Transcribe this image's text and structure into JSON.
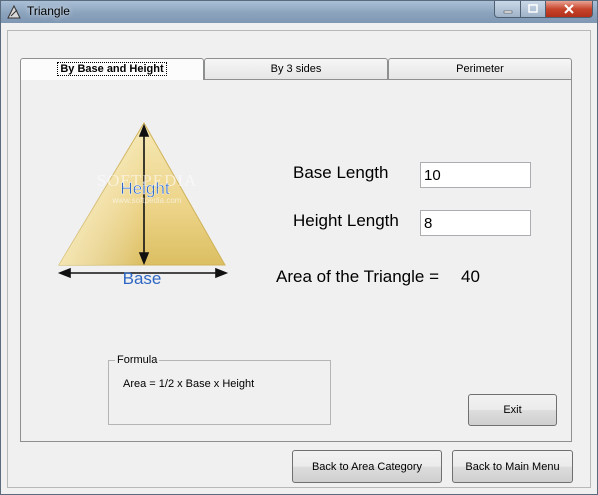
{
  "window": {
    "title": "Triangle"
  },
  "tabs": [
    {
      "label": "By Base and Height",
      "active": true
    },
    {
      "label": "By 3 sides",
      "active": false
    },
    {
      "label": "Perimeter",
      "active": false
    }
  ],
  "diagram": {
    "height_label": "Height",
    "base_label": "Base",
    "watermark": "SOFTPEDIA",
    "watermark_url": "www.softpedia.com"
  },
  "form": {
    "base_label": "Base Length",
    "base_value": "10",
    "height_label": "Height Length",
    "height_value": "8",
    "area_label": "Area of the Triangle =",
    "area_value": "40"
  },
  "formula": {
    "legend": "Formula",
    "text": "Area = 1/2 x Base  x Height"
  },
  "buttons": {
    "exit": "Exit",
    "back_area": "Back to Area Category",
    "back_main": "Back to Main Menu"
  },
  "colors": {
    "titlebar": "#8ba3bd",
    "triangle_light": "#f9eec0",
    "triangle_dark": "#dcbf63",
    "base_label": "#2f68c4"
  }
}
